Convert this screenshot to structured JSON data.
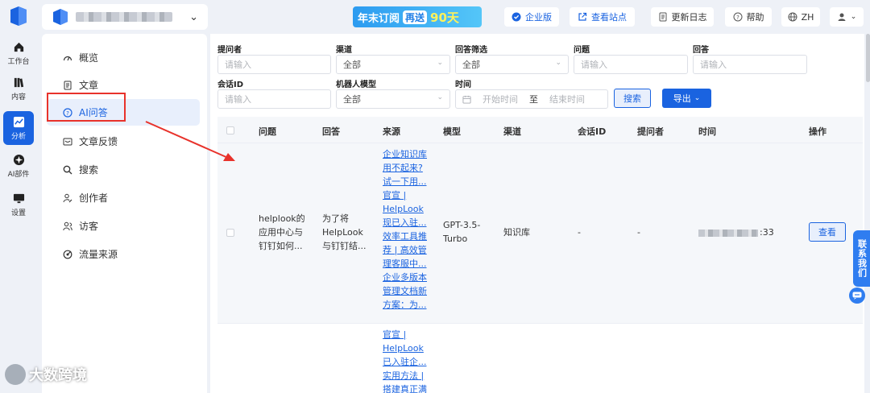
{
  "topbar": {
    "banner": {
      "part1": "年末订阅",
      "pill": "再送",
      "part2": "90天"
    },
    "enterprise_label": "企业版",
    "view_site_label": "查看站点",
    "changelog_label": "更新日志",
    "help_label": "帮助",
    "lang_label": "ZH"
  },
  "rail": [
    {
      "label": "工作台",
      "icon": "home-icon"
    },
    {
      "label": "内容",
      "icon": "books-icon"
    },
    {
      "label": "分析",
      "icon": "chart-icon"
    },
    {
      "label": "AI部件",
      "icon": "ai-widget-icon"
    },
    {
      "label": "设置",
      "icon": "monitor-icon"
    }
  ],
  "menu": [
    {
      "label": "概览",
      "icon": "overview-icon"
    },
    {
      "label": "文章",
      "icon": "article-icon"
    },
    {
      "label": "AI问答",
      "icon": "ai-qa-icon"
    },
    {
      "label": "文章反馈",
      "icon": "feedback-icon"
    },
    {
      "label": "搜索",
      "icon": "search-icon"
    },
    {
      "label": "创作者",
      "icon": "creator-icon"
    },
    {
      "label": "访客",
      "icon": "visitor-icon"
    },
    {
      "label": "流量来源",
      "icon": "traffic-icon"
    }
  ],
  "filters": {
    "asker": {
      "label": "提问者",
      "placeholder": "请输入"
    },
    "channel": {
      "label": "渠道",
      "value": "全部"
    },
    "answer_filter": {
      "label": "回答筛选",
      "value": "全部"
    },
    "question": {
      "label": "问题",
      "placeholder": "请输入"
    },
    "answer": {
      "label": "回答",
      "placeholder": "请输入"
    },
    "session_id": {
      "label": "会话ID",
      "placeholder": "请输入"
    },
    "bot_model": {
      "label": "机器人模型",
      "value": "全部"
    },
    "time": {
      "label": "时间",
      "start": "开始时间",
      "sep": "至",
      "end": "结束时间"
    },
    "search_label": "搜索",
    "export_label": "导出"
  },
  "table": {
    "headers": [
      "问题",
      "回答",
      "来源",
      "模型",
      "渠道",
      "会话ID",
      "提问者",
      "时间",
      "操作"
    ],
    "rows": [
      {
        "question": [
          "helplook的",
          "应用中心与",
          "钉钉如何..."
        ],
        "answer": [
          "为了将",
          "HelpLook",
          "与钉钉结..."
        ],
        "source": [
          "企业知识库",
          "用不起来?",
          "试一下用...",
          "官宣 |",
          "HelpLook",
          "现已入驻...",
          "效率工具推",
          "荐 | 高效管",
          "理客服中...",
          "企业多版本",
          "管理文档新",
          "方案：为..."
        ],
        "model": [
          "GPT-3.5-",
          "Turbo"
        ],
        "channel": "知识库",
        "session_id": "-",
        "asker": "-",
        "time_suffix": ":33",
        "action": "查看"
      },
      {
        "source": [
          "官宣 |",
          "HelpLook",
          "已入驻企...",
          "实用方法 |",
          "搭建真正满"
        ]
      }
    ]
  },
  "contact_label": "联系我们",
  "watermark": "大数跨境"
}
